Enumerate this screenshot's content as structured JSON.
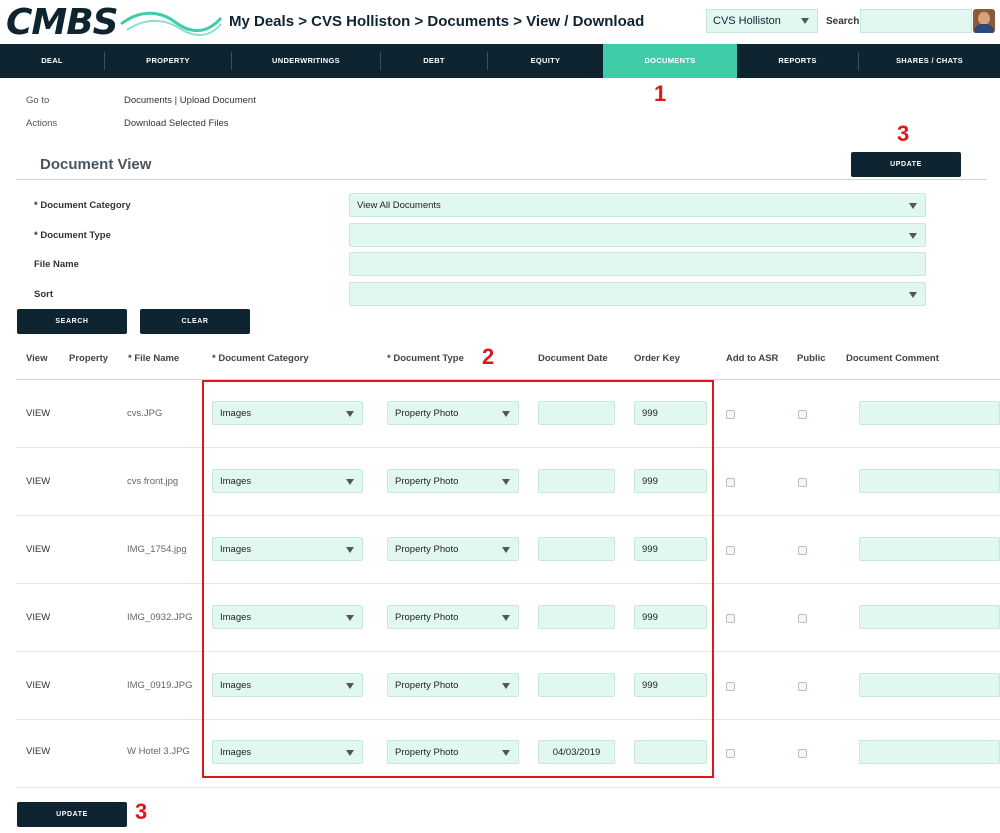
{
  "header": {
    "logo_text": "CMBS",
    "breadcrumb": "My Deals > CVS Holliston > Documents > View / Download",
    "deal_select": "CVS Holliston",
    "search_label": "Search"
  },
  "nav": {
    "items": [
      {
        "label": "DEAL"
      },
      {
        "label": "PROPERTY"
      },
      {
        "label": "UNDERWRITINGS"
      },
      {
        "label": "DEBT"
      },
      {
        "label": "EQUITY"
      },
      {
        "label": "DOCUMENTS",
        "active": true
      },
      {
        "label": "REPORTS"
      },
      {
        "label": "SHARES / CHATS"
      }
    ]
  },
  "meta": {
    "goto_label": "Go to",
    "goto_value": "Documents | Upload Document",
    "actions_label": "Actions",
    "actions_value": "Download Selected Files"
  },
  "annotations": [
    "1",
    "2",
    "3",
    "3"
  ],
  "document_view": {
    "title": "Document View",
    "update_label": "UPDATE",
    "fields": {
      "category_label": "* Document Category",
      "category_value": "View All Documents",
      "type_label": "* Document Type",
      "type_value": "",
      "filename_label": "File Name",
      "filename_value": "",
      "sort_label": "Sort",
      "sort_value": ""
    },
    "search_label": "SEARCH",
    "clear_label": "CLEAR"
  },
  "table": {
    "headers": [
      "View",
      "Property",
      "* File Name",
      "* Document Category",
      "* Document Type",
      "Document Date",
      "Order Key",
      "Add to ASR",
      "Public",
      "Document Comment"
    ],
    "rows": [
      {
        "view": "VIEW",
        "file": "cvs.JPG",
        "category": "Images",
        "type": "Property Photo",
        "date": "",
        "order_key": "999"
      },
      {
        "view": "VIEW",
        "file": "cvs front.jpg",
        "category": "Images",
        "type": "Property Photo",
        "date": "",
        "order_key": "999"
      },
      {
        "view": "VIEW",
        "file": "IMG_1754.jpg",
        "category": "Images",
        "type": "Property Photo",
        "date": "",
        "order_key": "999"
      },
      {
        "view": "VIEW",
        "file": "IMG_0932.JPG",
        "category": "Images",
        "type": "Property Photo",
        "date": "",
        "order_key": "999"
      },
      {
        "view": "VIEW",
        "file": "IMG_0919.JPG",
        "category": "Images",
        "type": "Property Photo",
        "date": "",
        "order_key": "999"
      },
      {
        "view": "VIEW",
        "file": "W Hotel 3.JPG",
        "category": "Images",
        "type": "Property Photo",
        "date": "04/03/2019",
        "order_key": ""
      }
    ]
  },
  "bottom_update_label": "UPDATE",
  "colors": {
    "navy": "#0f2431",
    "accent": "#3fcca8",
    "field_bg": "#e0f8f0",
    "annotation_red": "#e0181b"
  }
}
